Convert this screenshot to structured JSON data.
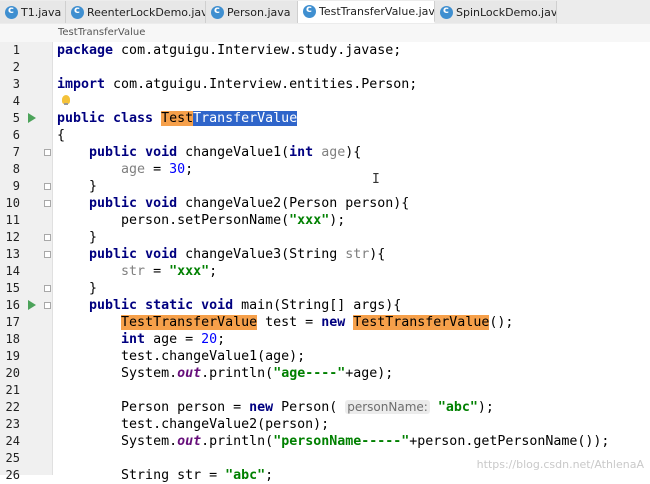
{
  "tabs": [
    {
      "label": "T1.java",
      "icon": "class-icon",
      "active": false
    },
    {
      "label": "ReenterLockDemo.java",
      "icon": "class-icon",
      "active": false
    },
    {
      "label": "Person.java",
      "icon": "class-icon",
      "active": false
    },
    {
      "label": "TestTransferValue.java",
      "icon": "class-icon",
      "active": true
    },
    {
      "label": "SpinLockDemo.java",
      "icon": "class-icon",
      "active": false
    }
  ],
  "close_glyph": "×",
  "breadcrumb": "TestTransferValue",
  "lines": [
    {
      "n": "1",
      "code": "package com.atguigu.Interview.study.javase;"
    },
    {
      "n": "2",
      "code": ""
    },
    {
      "n": "3",
      "code": "import com.atguigu.Interview.entities.Person;"
    },
    {
      "n": "4",
      "code": ""
    },
    {
      "n": "5",
      "code": "public class TestTransferValue"
    },
    {
      "n": "6",
      "code": "{"
    },
    {
      "n": "7",
      "code": "    public void changeValue1(int age){"
    },
    {
      "n": "8",
      "code": "        age = 30;"
    },
    {
      "n": "9",
      "code": "    }"
    },
    {
      "n": "10",
      "code": "    public void changeValue2(Person person){"
    },
    {
      "n": "11",
      "code": "        person.setPersonName(\"xxx\");"
    },
    {
      "n": "12",
      "code": "    }"
    },
    {
      "n": "13",
      "code": "    public void changeValue3(String str){"
    },
    {
      "n": "14",
      "code": "        str = \"xxx\";"
    },
    {
      "n": "15",
      "code": "    }"
    },
    {
      "n": "16",
      "code": "    public static void main(String[] args){"
    },
    {
      "n": "17",
      "code": "        TestTransferValue test = new TestTransferValue();"
    },
    {
      "n": "18",
      "code": "        int age = 20;"
    },
    {
      "n": "19",
      "code": "        test.changeValue1(age);"
    },
    {
      "n": "20",
      "code": "        System.out.println(\"age----\"+age);"
    },
    {
      "n": "21",
      "code": ""
    },
    {
      "n": "22",
      "code": "        Person person = new Person( personName: \"abc\");"
    },
    {
      "n": "23",
      "code": "        test.changeValue2(person);"
    },
    {
      "n": "24",
      "code": "        System.out.println(\"personName-----\"+person.getPersonName());"
    },
    {
      "n": "25",
      "code": ""
    },
    {
      "n": "26",
      "code": "        String str = \"abc\";"
    }
  ],
  "watermark": "https://blog.csdn.net/AthlenaA",
  "colors": {
    "keyword": "#000080",
    "string": "#008000",
    "number": "#0000ff",
    "usage_highlight": "#f6a04a",
    "selection": "#2f65ca"
  }
}
